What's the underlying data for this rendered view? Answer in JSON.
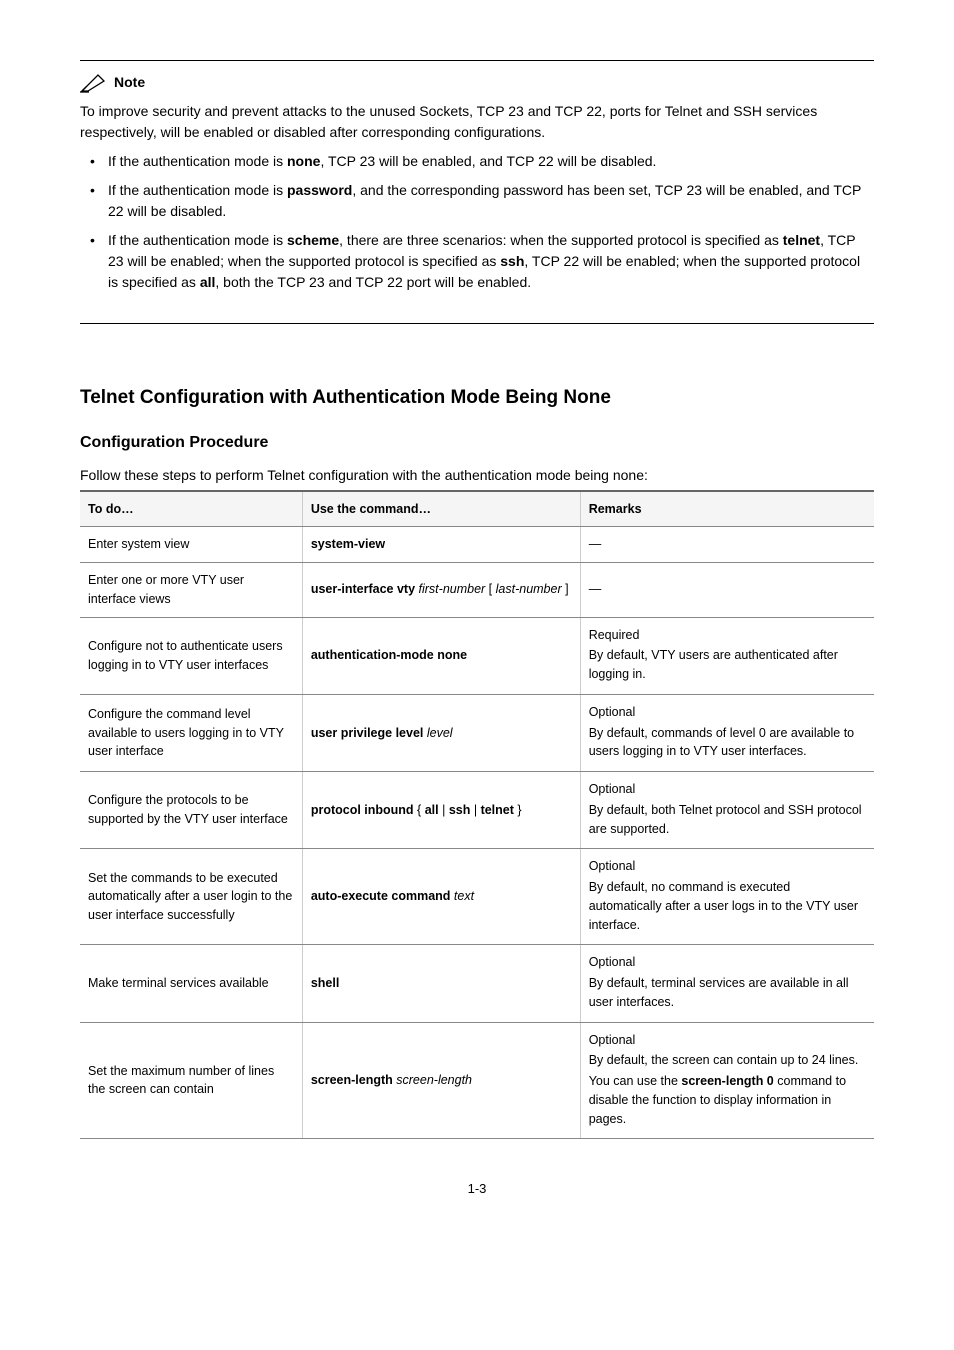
{
  "note": {
    "label": "Note",
    "intro": "To improve security and prevent attacks to the unused Sockets, TCP 23 and TCP 22, ports for Telnet and SSH services respectively, will be enabled or disabled after corresponding configurations.",
    "bullets": [
      {
        "pre": "If the authentication mode is ",
        "mode": "none",
        "post": ", TCP 23 will be enabled, and TCP 22 will be disabled."
      },
      {
        "pre": "If the authentication mode is ",
        "mode": "password",
        "post": ", and the corresponding password has been set, TCP 23 will be enabled, and TCP 22 will be disabled."
      },
      {
        "pre": "If the authentication mode is ",
        "mode": "scheme",
        "mid1": ", there are three scenarios: when the supported protocol is specified as ",
        "proto1": "telnet",
        "mid2": ", TCP 23 will be enabled; when the supported protocol is specified as ",
        "proto2": "ssh",
        "mid3": ", TCP 22 will be enabled; when the supported protocol is specified as ",
        "proto3": "all",
        "post": ", both the TCP 23 and TCP 22 port will be enabled."
      }
    ]
  },
  "headings": {
    "section": "Telnet Configuration with Authentication Mode Being None",
    "subsection": "Configuration Procedure",
    "steps_caption": "Follow these steps to perform Telnet configuration with the authentication mode being none:"
  },
  "table": {
    "headers": {
      "todo": "To do…",
      "cmd": "Use the command…",
      "remarks": "Remarks"
    },
    "rows": [
      {
        "todo": "Enter system view",
        "cmd_bold": "system-view",
        "remarks_dash": "—"
      },
      {
        "todo": "Enter one or more VTY user interface views",
        "cmd_bold_a": "user-interface vty",
        "cmd_ital_a": "first-number",
        "cmd_plain_a": " [ ",
        "cmd_ital_b": "last-number",
        "cmd_plain_b": " ]",
        "remarks_dash": "—"
      },
      {
        "todo": "Configure not to authenticate users logging in to VTY user interfaces",
        "cmd_bold": "authentication-mode none",
        "remarks_lines": [
          "Required",
          "By default, VTY users are authenticated after logging in."
        ]
      },
      {
        "todo": "Configure the command level available to users logging in to VTY user interface",
        "cmd_bold": "user privilege level",
        "cmd_ital": "level",
        "remarks_lines": [
          "Optional",
          "By default, commands of level 0 are available to users logging in to VTY user interfaces."
        ]
      },
      {
        "todo": "Configure the protocols to be supported by the VTY user interface",
        "cmd_bold_a": "protocol inbound",
        "cmd_plain_a": " { ",
        "cmd_bold_b": "all",
        "cmd_plain_b": " | ",
        "cmd_bold_c": "ssh",
        "cmd_plain_c": " | ",
        "cmd_bold_d": "telnet",
        "cmd_plain_d": " }",
        "remarks_lines": [
          "Optional",
          "By default, both Telnet protocol and SSH protocol are supported."
        ]
      },
      {
        "todo": "Set the commands to be executed automatically after a user login to the user interface successfully",
        "cmd_bold": "auto-execute command",
        "cmd_ital": "text",
        "remarks_lines": [
          "Optional",
          "By default, no command is executed automatically after a user logs in to the VTY user interface."
        ]
      },
      {
        "todo": "Make terminal services available",
        "cmd_bold": "shell",
        "remarks_lines": [
          "Optional",
          "By default, terminal services are available in all user interfaces."
        ]
      },
      {
        "todo": "Set the maximum number of lines the screen can contain",
        "cmd_bold": "screen-length",
        "cmd_ital": "screen-length",
        "remarks_lines": [
          "Optional",
          "By default, the screen can contain up to 24 lines."
        ],
        "remarks_tail_pre": "You can use the ",
        "remarks_tail_bold": "screen-length 0",
        "remarks_tail_post": " command to disable the function to display information in pages."
      }
    ]
  },
  "page_number": "1-3"
}
